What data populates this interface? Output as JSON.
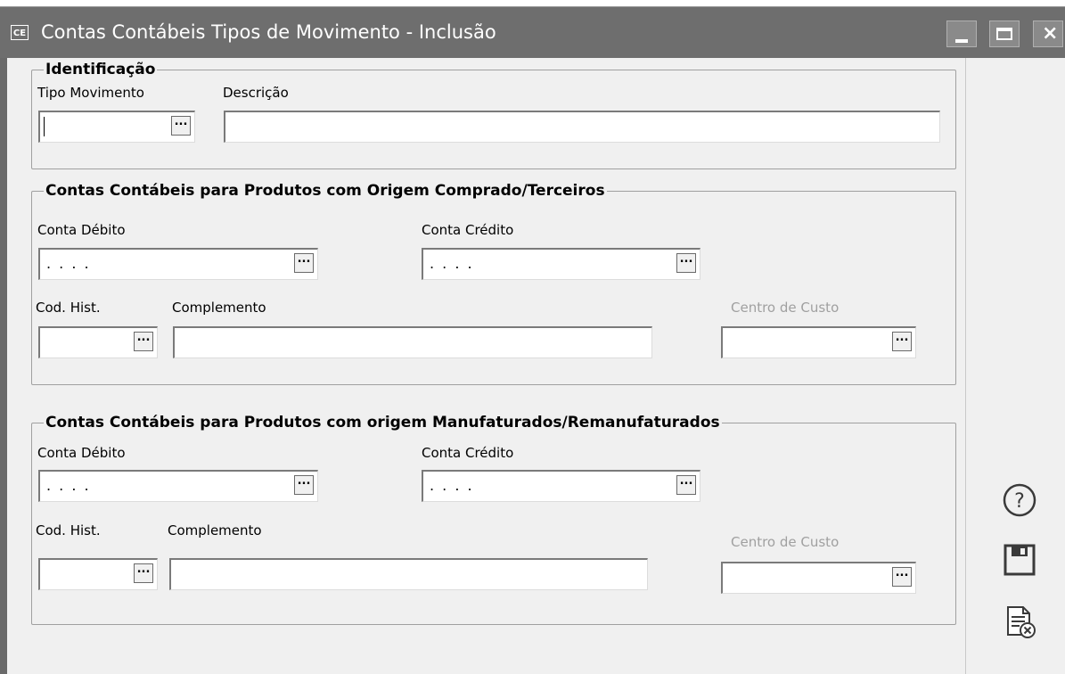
{
  "window": {
    "app_icon": "CE",
    "title": "Contas Contábeis Tipos de Movimento - Inclusão",
    "controls": [
      "minimize-icon",
      "maximize-icon",
      "close-icon"
    ]
  },
  "identificacao": {
    "title": "Identificação",
    "tipo_movimento": {
      "label": "Tipo Movimento",
      "value": ""
    },
    "descricao": {
      "label": "Descrição",
      "value": ""
    }
  },
  "comprado": {
    "title": "Contas Contábeis para Produtos com Origem Comprado/Terceiros",
    "conta_debito": {
      "label": "Conta Débito",
      "value": ". . . ."
    },
    "conta_credito": {
      "label": "Conta Crédito",
      "value": ". . . ."
    },
    "cod_hist": {
      "label": "Cod. Hist.",
      "value": ""
    },
    "complemento": {
      "label": "Complemento",
      "value": ""
    },
    "centro_custo": {
      "label": "Centro de Custo",
      "value": "",
      "enabled": false
    }
  },
  "manufaturado": {
    "title": "Contas Contábeis para Produtos com origem Manufaturados/Remanufaturados",
    "conta_debito": {
      "label": "Conta Débito",
      "value": ". . . ."
    },
    "conta_credito": {
      "label": "Conta Crédito",
      "value": ". . . ."
    },
    "cod_hist": {
      "label": "Cod. Hist.",
      "value": ""
    },
    "complemento": {
      "label": "Complemento",
      "value": ""
    },
    "centro_custo": {
      "label": "Centro de Custo",
      "value": "",
      "enabled": false
    }
  },
  "lookup_button_label": "...",
  "side_actions": [
    "help-icon",
    "save-icon",
    "cancel-document-icon"
  ],
  "colors": {
    "titlebar": "#6e6e6e",
    "panel": "#f0f0f0",
    "disabled_text": "#a0a0a0"
  }
}
